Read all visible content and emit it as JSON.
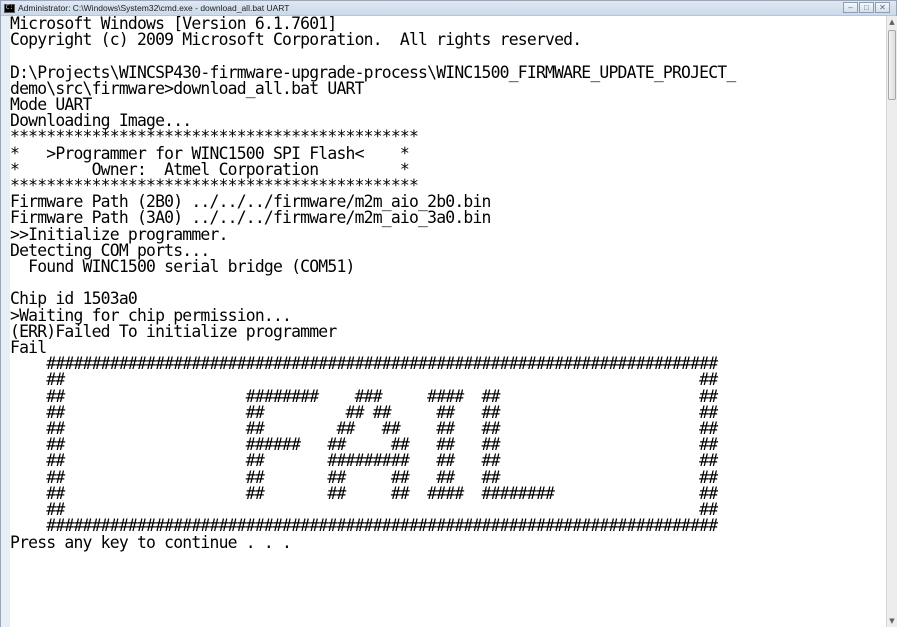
{
  "window": {
    "title": "Administrator: C:\\Windows\\System32\\cmd.exe - download_all.bat  UART",
    "icon": "cmd-icon",
    "buttons": {
      "minimize": "minimize-icon",
      "maximize": "maximize-icon",
      "close": "close-icon"
    }
  },
  "console": {
    "lines": [
      "Microsoft Windows [Version 6.1.7601]",
      "Copyright (c) 2009 Microsoft Corporation.  All rights reserved.",
      "",
      "D:\\Projects\\WINCSP430-firmware-upgrade-process\\WINC1500_FIRMWARE_UPDATE_PROJECT_",
      "demo\\src\\firmware>download_all.bat UART",
      "Mode UART",
      "Downloading Image...",
      "*********************************************",
      "*   >Programmer for WINC1500 SPI Flash<    *",
      "*        Owner:  Atmel Corporation         *",
      "*********************************************",
      "Firmware Path (2B0) ../../../firmware/m2m_aio_2b0.bin",
      "Firmware Path (3A0) ../../../firmware/m2m_aio_3a0.bin",
      ">>Initialize programmer.",
      "Detecting COM ports...",
      "  Found WINC1500 serial bridge (COM51)",
      "",
      "Chip id 1503a0",
      ">Waiting for chip permission...",
      "(ERR)Failed To initialize programmer",
      "Fail",
      "    ##########################################################################",
      "    ##                                                                      ##",
      "    ##                    ########    ###     ####  ##                      ##",
      "    ##                    ##         ## ##     ##   ##                      ##",
      "    ##                    ##        ##   ##    ##   ##                      ##",
      "    ##                    ######   ##     ##   ##   ##                      ##",
      "    ##                    ##       #########   ##   ##                      ##",
      "    ##                    ##       ##     ##   ##   ##                      ##",
      "    ##                    ##       ##     ##  ####  ########                ##",
      "    ##                                                                      ##",
      "    ##########################################################################",
      "Press any key to continue . . ."
    ]
  },
  "scrollbar": {
    "up_arrow": "▲",
    "down_arrow": "▼"
  }
}
